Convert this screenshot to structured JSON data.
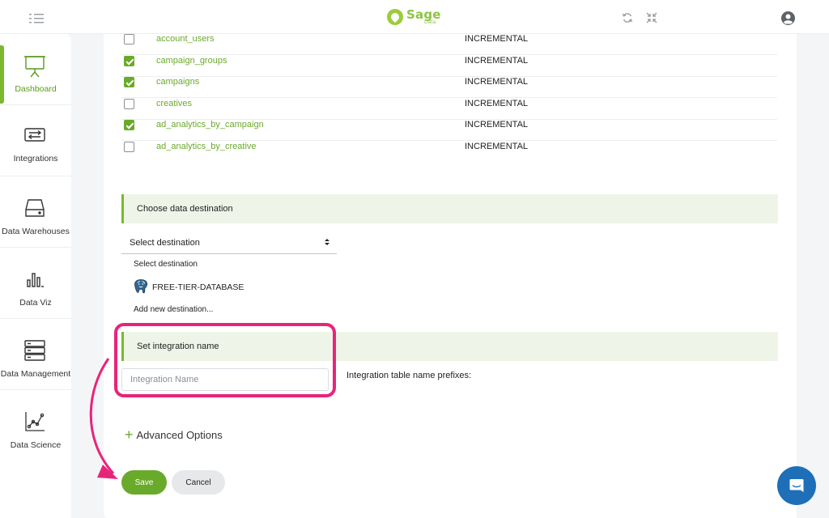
{
  "header": {
    "logo_name": "Sage",
    "logo_sub": "Data"
  },
  "sidebar": {
    "items": [
      {
        "label": "Dashboard",
        "icon": "presentation-board-icon",
        "active": true
      },
      {
        "label": "Integrations",
        "icon": "swap-arrows-icon",
        "active": false
      },
      {
        "label": "Data Warehouses",
        "icon": "hard-drive-icon",
        "active": false
      },
      {
        "label": "Data Viz",
        "icon": "bar-chart-icon",
        "active": false
      },
      {
        "label": "Data Management",
        "icon": "server-stack-icon",
        "active": false
      },
      {
        "label": "Data Science",
        "icon": "scatter-line-icon",
        "active": false
      }
    ]
  },
  "streams": [
    {
      "name": "account_users",
      "mode": "INCREMENTAL",
      "checked": false
    },
    {
      "name": "campaign_groups",
      "mode": "INCREMENTAL",
      "checked": true
    },
    {
      "name": "campaigns",
      "mode": "INCREMENTAL",
      "checked": true
    },
    {
      "name": "creatives",
      "mode": "INCREMENTAL",
      "checked": false
    },
    {
      "name": "ad_analytics_by_campaign",
      "mode": "INCREMENTAL",
      "checked": true
    },
    {
      "name": "ad_analytics_by_creative",
      "mode": "INCREMENTAL",
      "checked": false
    }
  ],
  "destination": {
    "section_title": "Choose data destination",
    "selected": "Select destination",
    "options": [
      "Select destination",
      "FREE-TIER-DATABASE",
      "Add new destination..."
    ]
  },
  "integration_name": {
    "section_title": "Set integration name",
    "placeholder": "Integration Name",
    "value": "",
    "prefix_label": "Integration table name prefixes:"
  },
  "advanced": {
    "plus": "+",
    "label": "Advanced Options"
  },
  "actions": {
    "save_label": "Save",
    "cancel_label": "Cancel"
  },
  "colors": {
    "accent": "#6aaa2a",
    "annotation": "#e8247a",
    "chat": "#1e6fb8"
  }
}
